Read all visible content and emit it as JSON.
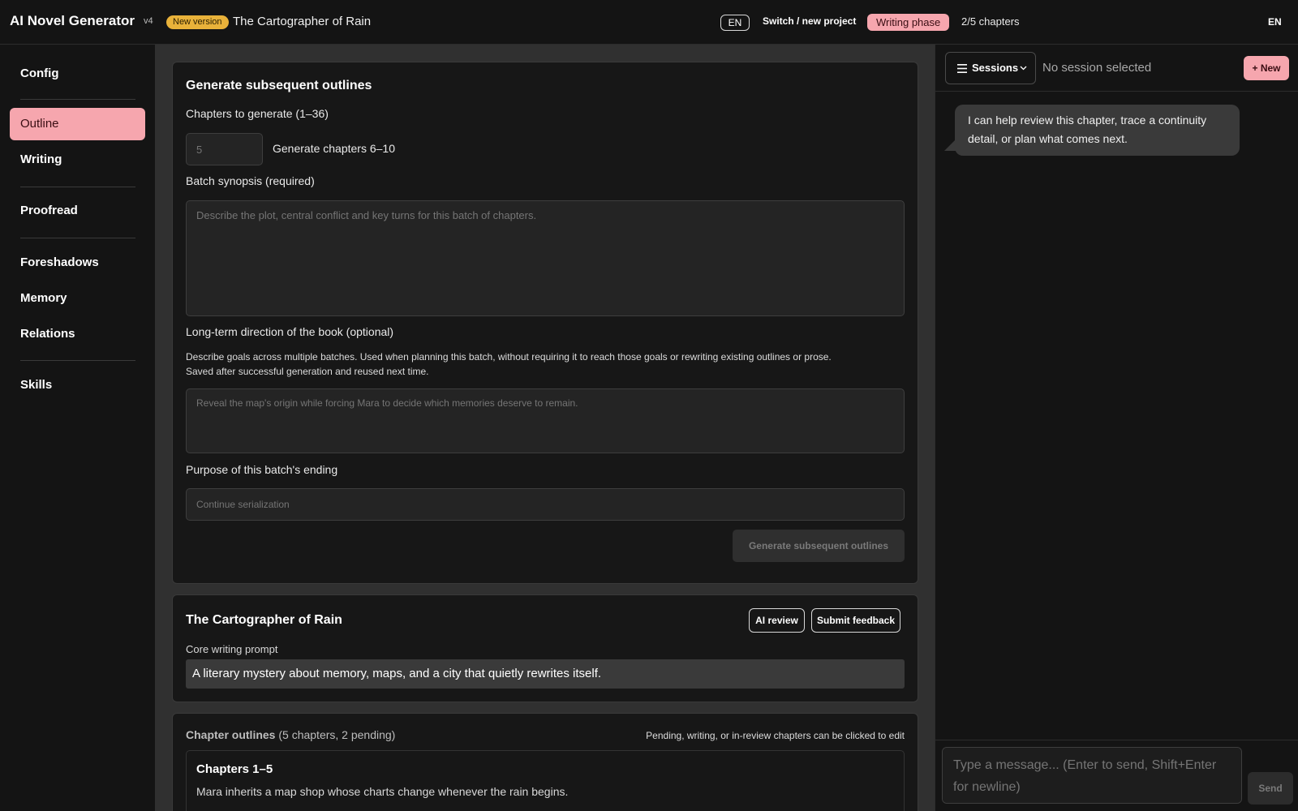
{
  "app": {
    "title": "AI Novel Generator",
    "version": "v4",
    "new_version_badge": "New version",
    "project_name": "The Cartographer of Rain",
    "language": "EN",
    "switch_project": "Switch / new project",
    "phase": "Writing phase",
    "chapters_progress": "2/5 chapters",
    "language_right": "EN"
  },
  "colors": {
    "accent": "#f6a6ae",
    "badge": "#e9b23a",
    "background": "#141414",
    "main_background": "#303030"
  },
  "sidebar": {
    "items": [
      {
        "label": "Config"
      },
      {
        "label": "Outline"
      },
      {
        "label": "Writing"
      },
      {
        "label": "Proofread"
      },
      {
        "label": "Foreshadows"
      },
      {
        "label": "Memory"
      },
      {
        "label": "Relations"
      },
      {
        "label": "Skills"
      }
    ],
    "active": "Outline"
  },
  "generate": {
    "title": "Generate subsequent outlines",
    "count_label": "Chapters to generate (1–36)",
    "count_placeholder": "5",
    "range_text": "Generate chapters 6–10",
    "synopsis_label": "Batch synopsis (required)",
    "synopsis_placeholder": "Describe the plot, central conflict and key turns for this batch of chapters.",
    "direction_label": "Long-term direction of the book (optional)",
    "direction_hint_1": "Describe goals across multiple batches. Used when planning this batch, without requiring it to reach those goals or rewriting existing outlines or prose.",
    "direction_hint_2": "Saved after successful generation and reused next time.",
    "direction_placeholder": "Reveal the map's origin while forcing Mara to decide which memories deserve to remain.",
    "ending_label": "Purpose of this batch's ending",
    "ending_placeholder": "Continue serialization",
    "submit_label": "Generate subsequent outlines"
  },
  "book": {
    "title": "The Cartographer of Rain",
    "ai_review": "AI review",
    "submit_feedback": "Submit feedback",
    "prompt_label": "Core writing prompt",
    "prompt_value": "A literary mystery about memory, maps, and a city that quietly rewrites itself."
  },
  "outlines": {
    "title": "Chapter outlines",
    "count": "(5 chapters, 2 pending)",
    "hint": "Pending, writing, or in-review chapters can be clicked to edit",
    "group_title": "Chapters 1–5",
    "group_summary": "Mara inherits a map shop whose charts change whenever the rain begins."
  },
  "chat": {
    "sessions_label": "Sessions",
    "no_session": "No session selected",
    "new_label": "+ New",
    "assistant_message": "I can help review this chapter, trace a continuity detail, or plan what comes next.",
    "input_placeholder": "Type a message... (Enter to send, Shift+Enter for newline)",
    "send_label": "Send"
  }
}
